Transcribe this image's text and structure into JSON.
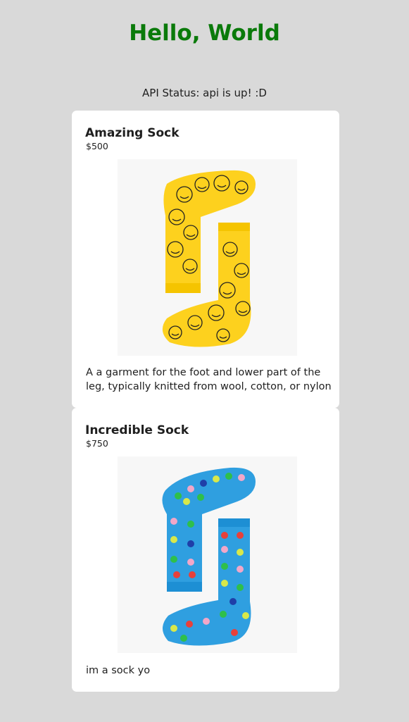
{
  "header": {
    "title": "Hello, World"
  },
  "status": {
    "text": "API Status: api is up! :D"
  },
  "products": [
    {
      "name": "Amazing Sock",
      "price": "$500",
      "description": "A a garment for the foot and lower part of the leg, typically knitted from wool, cotton, or nylon",
      "image_icon": "yellow-smiley-sock-icon",
      "image_color": "#fdd11e"
    },
    {
      "name": "Incredible Sock",
      "price": "$750",
      "description": "im a sock yo",
      "image_icon": "blue-polka-dot-sock-icon",
      "image_color": "#2f9fe0"
    }
  ],
  "colors": {
    "background": "#d9d9d9",
    "title": "#0a7a0a",
    "card": "#ffffff"
  }
}
